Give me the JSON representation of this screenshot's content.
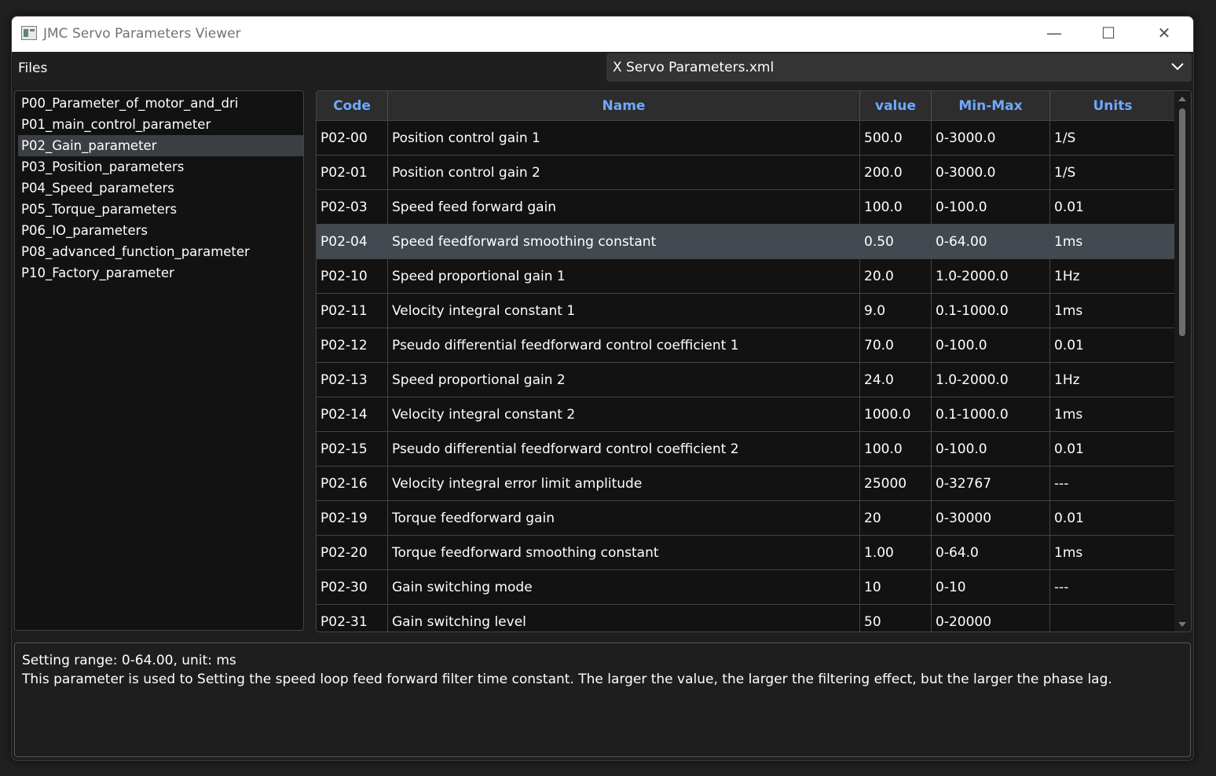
{
  "window": {
    "title": "JMC Servo Parameters Viewer",
    "controls": {
      "minimize": "—",
      "maximize": "☐",
      "close": "✕"
    }
  },
  "menubar": {
    "files_label": "Files",
    "file_selector": {
      "selected": "X Servo Parameters.xml"
    }
  },
  "sidebar": {
    "items": [
      {
        "label": "P00_Parameter_of_motor_and_dri",
        "selected": false
      },
      {
        "label": "P01_main_control_parameter",
        "selected": false
      },
      {
        "label": "P02_Gain_parameter",
        "selected": true
      },
      {
        "label": "P03_Position_parameters",
        "selected": false
      },
      {
        "label": "P04_Speed_parameters",
        "selected": false
      },
      {
        "label": "P05_Torque_parameters",
        "selected": false
      },
      {
        "label": "P06_IO_parameters",
        "selected": false
      },
      {
        "label": "P08_advanced_function_parameter",
        "selected": false
      },
      {
        "label": "P10_Factory_parameter",
        "selected": false
      }
    ]
  },
  "table": {
    "headers": {
      "code": "Code",
      "name": "Name",
      "value": "value",
      "minmax": "Min-Max",
      "units": "Units"
    },
    "rows": [
      {
        "code": "P02-00",
        "name": "Position control gain 1",
        "value": "500.0",
        "minmax": "0-3000.0",
        "units": "1/S"
      },
      {
        "code": "P02-01",
        "name": "Position control gain 2",
        "value": "200.0",
        "minmax": "0-3000.0",
        "units": "1/S"
      },
      {
        "code": "P02-03",
        "name": "Speed feed forward gain",
        "value": "100.0",
        "minmax": "0-100.0",
        "units": "0.01"
      },
      {
        "code": "P02-04",
        "name": "Speed feedforward smoothing constant",
        "value": "0.50",
        "minmax": "0-64.00",
        "units": "1ms"
      },
      {
        "code": "P02-10",
        "name": "Speed proportional gain 1",
        "value": "20.0",
        "minmax": "1.0-2000.0",
        "units": "1Hz"
      },
      {
        "code": "P02-11",
        "name": "Velocity integral constant 1",
        "value": "9.0",
        "minmax": "0.1-1000.0",
        "units": "1ms"
      },
      {
        "code": "P02-12",
        "name": "Pseudo differential feedforward control coefficient 1",
        "value": "70.0",
        "minmax": "0-100.0",
        "units": "0.01"
      },
      {
        "code": "P02-13",
        "name": "Speed proportional gain 2",
        "value": "24.0",
        "minmax": "1.0-2000.0",
        "units": "1Hz"
      },
      {
        "code": "P02-14",
        "name": "Velocity integral constant 2",
        "value": "1000.0",
        "minmax": "0.1-1000.0",
        "units": "1ms"
      },
      {
        "code": "P02-15",
        "name": "Pseudo differential feedforward control coefficient 2",
        "value": "100.0",
        "minmax": "0-100.0",
        "units": "0.01"
      },
      {
        "code": "P02-16",
        "name": "Velocity integral error limit amplitude",
        "value": "25000",
        "minmax": "0-32767",
        "units": "---"
      },
      {
        "code": "P02-19",
        "name": "Torque feedforward gain",
        "value": "20",
        "minmax": "0-30000",
        "units": "0.01"
      },
      {
        "code": "P02-20",
        "name": "Torque feedforward smoothing constant",
        "value": "1.00",
        "minmax": "0-64.0",
        "units": "1ms"
      },
      {
        "code": "P02-30",
        "name": "Gain switching mode",
        "value": "10",
        "minmax": "0-10",
        "units": "---"
      },
      {
        "code": "P02-31",
        "name": "Gain switching level",
        "value": "50",
        "minmax": "0-20000",
        "units": ""
      }
    ],
    "selected_index": 3
  },
  "description": {
    "line1": "Setting range: 0-64.00, unit: ms",
    "line2": "This parameter is used to Setting the speed loop feed forward filter time constant. The larger the value, the larger the filtering effect, but the larger the phase lag."
  },
  "colors": {
    "header_text": "#6fa8ff",
    "selection": "#434950"
  }
}
